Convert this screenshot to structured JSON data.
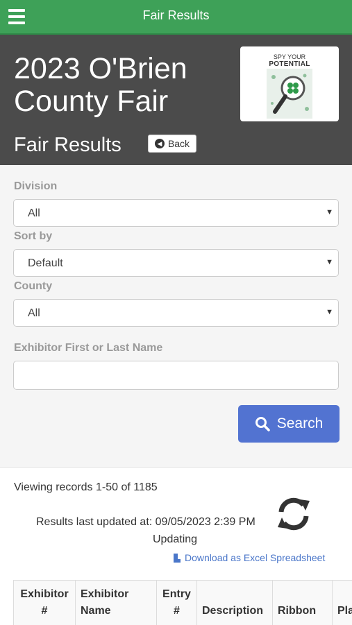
{
  "topbar": {
    "title": "Fair Results"
  },
  "header": {
    "fair_title": "2023 O'Brien County Fair",
    "section_title": "Fair Results",
    "back_label": "Back",
    "logo": {
      "line1": "SPY YOUR",
      "line2": "POTENTIAL"
    }
  },
  "filters": {
    "division": {
      "label": "Division",
      "value": "All"
    },
    "sort_by": {
      "label": "Sort by",
      "value": "Default"
    },
    "county": {
      "label": "County",
      "value": "All"
    },
    "name": {
      "label": "Exhibitor First or Last Name",
      "value": "",
      "placeholder": ""
    },
    "search_label": "Search"
  },
  "results": {
    "records_text": "Viewing records 1-50 of 1185",
    "updated_text": "Results last updated at: 09/05/2023 2:39 PM",
    "status_text": "Updating",
    "download_label": "Download as Excel Spreadsheet"
  },
  "table": {
    "headers": [
      "Exhibitor #",
      "Exhibitor Name",
      "Entry #",
      "Description",
      "Ribbon",
      "Pla"
    ]
  },
  "colors": {
    "topbar": "#3ea158",
    "header": "#4b4b4b",
    "search_button": "#5273d1",
    "link": "#4a76c9"
  },
  "icons": [
    "hamburger-menu-icon",
    "back-arrow-icon",
    "search-icon",
    "refresh-icon",
    "file-icon",
    "select-caret-icon"
  ]
}
